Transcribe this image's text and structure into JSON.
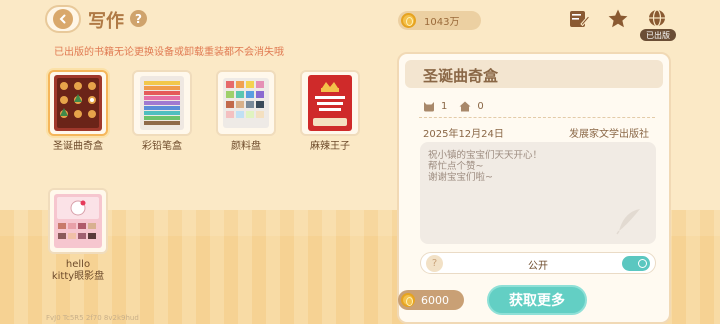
{
  "header": {
    "title": "写作",
    "coins": "1043万",
    "published_tag": "已出版"
  },
  "notice": "已出版的书籍无论更换设备或卸载重装都不会消失哦",
  "books": [
    {
      "label": "圣诞曲奇盒",
      "selected": true
    },
    {
      "label": "彩铅笔盒",
      "selected": false
    },
    {
      "label": "颜料盘",
      "selected": false
    },
    {
      "label": "麻辣王子",
      "selected": false
    },
    {
      "label": "hello\nkitty眼影盘",
      "selected": false
    }
  ],
  "panel": {
    "title": "圣诞曲奇盒",
    "stat_a": "1",
    "stat_b": "0",
    "date": "2025年12月24日",
    "publisher": "发展家文学出版社",
    "description": [
      "祝小镇的宝宝们天天开心！",
      "帮忙点个赞~",
      "谢谢宝宝们啦~"
    ],
    "public_label": "公开",
    "price": "6000",
    "get_more_label": "获取更多"
  },
  "footer": "FvJ0  Tc5R5  2f70  8v2k9hud",
  "colors": {
    "accent_teal": "#63cfc4",
    "title_brown": "#b07a45",
    "notice_orange": "#e07a52"
  }
}
